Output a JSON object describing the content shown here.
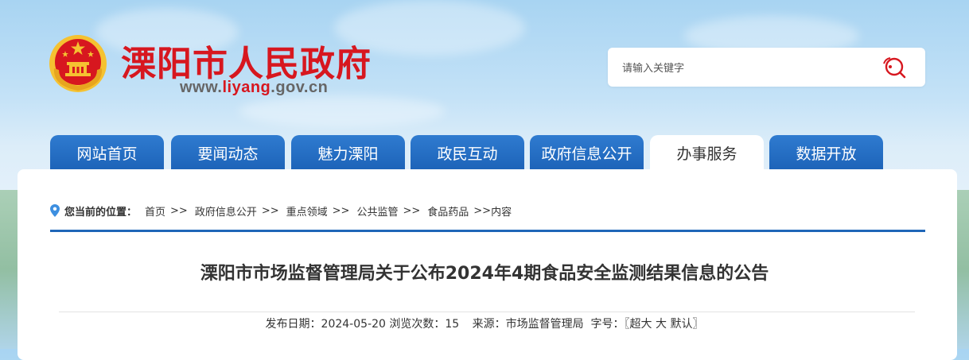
{
  "header": {
    "site_title": "溧阳市人民政府",
    "site_url_prefix": "www.",
    "site_url_highlight": "liyang",
    "site_url_suffix": ".gov.cn",
    "emblem_icon": "national-emblem-icon",
    "brand_color": "#d7171f"
  },
  "search": {
    "placeholder": "请输入关键字",
    "icon": "search-icon"
  },
  "nav": {
    "tabs": [
      {
        "label": "网站首页"
      },
      {
        "label": "要闻动态"
      },
      {
        "label": "魅力溧阳"
      },
      {
        "label": "政民互动"
      },
      {
        "label": "政府信息公开"
      },
      {
        "label": "办事服务",
        "active": true
      },
      {
        "label": "数据开放"
      }
    ],
    "tab_color": "#1d63b8"
  },
  "breadcrumb": {
    "label": "您当前的位置：",
    "items": [
      "首页",
      "政府信息公开",
      "重点领域",
      "公共监管",
      "食品药品"
    ],
    "separator": ">>",
    "current": "内容",
    "icon": "location-pin-icon"
  },
  "article": {
    "title": "溧阳市市场监督管理局关于公布2024年4期食品安全监测结果信息的公告",
    "publish_label": "发布日期：",
    "publish_date": "2024-05-20",
    "views_label": "浏览次数：",
    "views": "15",
    "source_label": "来源：",
    "source": "市场监督管理局",
    "fontsize_label": "字号：",
    "fontsize_open": "〖",
    "fontsize_options": [
      "超大",
      "大",
      "默认"
    ],
    "fontsize_close": "〗"
  }
}
